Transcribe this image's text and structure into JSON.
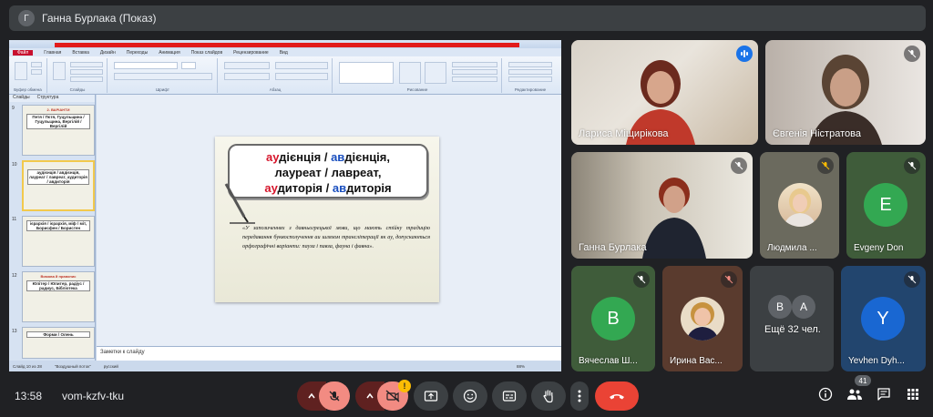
{
  "meeting": {
    "title": "Ганна Бурлака (Показ)",
    "presenter_initial": "Г",
    "time": "13:58",
    "code": "vom-kzfv-tku",
    "participant_count": "41"
  },
  "presentation": {
    "window_title": "Microsoft PowerPoint",
    "menu": [
      "Файл",
      "Главная",
      "Вставка",
      "Дизайн",
      "Переходы",
      "Анимация",
      "Показ слайдов",
      "Рецензирование",
      "Вид"
    ],
    "ribbon_groups": [
      "Буфер обмена",
      "Слайды",
      "Шрифт",
      "Абзац",
      "Рисование",
      "Редактирование"
    ],
    "left_tabs": [
      "Слайды",
      "Структура"
    ],
    "thumbs": [
      {
        "num": "9",
        "title": "2. ВАРІАНТИ",
        "body": "Петя / Пєтя, Гуцульщина / Гуцульщина, Вергілій / Вергілій"
      },
      {
        "num": "10",
        "title": "",
        "body": "аудієнція / авдієнція, лауреат / лавреат, аудиторія / авдиторія"
      },
      {
        "num": "11",
        "title": "",
        "body": "ієрархія / ієрархія, міф / міт, Борисфен / Бористен"
      },
      {
        "num": "12",
        "title": "Вимова й правопис",
        "body": "Юпітер / Юпитер, радіус / радиус, Бібліотека"
      },
      {
        "num": "13",
        "title": "",
        "body": "Форми / Олень"
      }
    ],
    "slide": {
      "line1_pre": "ау",
      "line1_mid": "дієнція / ",
      "line1_alt": "ав",
      "line1_post": "дієнція,",
      "line2_a": "лау",
      "line2_b": "реат / ",
      "line2_c": "лав",
      "line2_d": "реат,",
      "line3_a": "ау",
      "line3_b": "диторія / ",
      "line3_c": "ав",
      "line3_d": "диторія",
      "quote": "«У запозиченнях з давньогрецької мови, що мають стійку традицію передавання буквосполучення au шляхом транслітерації як ау, допускаються орфографічні варіанти: пауза і павза, фауна і фавна»."
    },
    "notes_placeholder": "Заметки к слайду",
    "status": [
      "Слайд 10 из 28",
      "\"Воздушный поток\"",
      "русский",
      "88%"
    ]
  },
  "participants": [
    {
      "name": "Лариса Міщирікова",
      "speaking": true
    },
    {
      "name": "Євгенія Ністратова",
      "muted": true
    },
    {
      "name": "Ганна Бурлака",
      "muted": true
    },
    {
      "name": "Людмила ...",
      "muted": true
    },
    {
      "name": "Evgeny Don",
      "initial": "E",
      "color": "#33a852",
      "muted": true
    },
    {
      "name": "Вячеслав Ш...",
      "initial": "В",
      "color": "#33a852",
      "muted": true
    },
    {
      "name": "Ирина Вас...",
      "muted": true
    },
    {
      "name": "Ещё 32 чел.",
      "initials": [
        "В",
        "А"
      ]
    },
    {
      "name": "Yevhen Dyh...",
      "initial": "Y",
      "color": "#1967d2",
      "muted": true
    }
  ],
  "colors": {
    "accent": "#1a73e8",
    "hangup": "#ea4335",
    "muted_bg": "#f28b82"
  }
}
